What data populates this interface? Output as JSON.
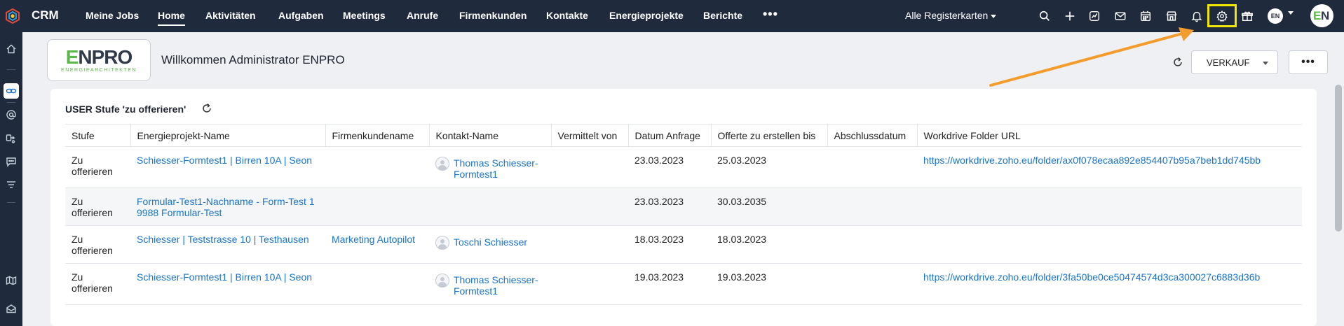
{
  "app": {
    "title": "CRM"
  },
  "nav": {
    "items": [
      {
        "label": "Meine Jobs"
      },
      {
        "label": "Home"
      },
      {
        "label": "Aktivitäten"
      },
      {
        "label": "Aufgaben"
      },
      {
        "label": "Meetings"
      },
      {
        "label": "Anrufe"
      },
      {
        "label": "Firmenkunden"
      },
      {
        "label": "Kontakte"
      },
      {
        "label": "Energieprojekte"
      },
      {
        "label": "Berichte"
      }
    ],
    "more": "•••",
    "tabs_dropdown": "Alle Registerkarten",
    "lang": "EN"
  },
  "icons": {
    "toolbar": [
      "search-icon",
      "plus-icon",
      "activity-chart-icon",
      "mail-icon",
      "calendar-icon",
      "store-icon",
      "bell-icon",
      "settings-icon",
      "gift-icon"
    ],
    "sidebar": [
      "home-icon",
      "link-icon",
      "at-sign-icon",
      "share-icon",
      "chat-icon",
      "filter-icon",
      "map-icon",
      "inbox-icon"
    ]
  },
  "header": {
    "logo_main_green": "E",
    "logo_main": "NPRO",
    "logo_sub": "ENERGIEARCHITEKTEN",
    "welcome": "Willkommen Administrator ENPRO",
    "view_select": "VERKAUF",
    "more": "•••"
  },
  "card": {
    "title": "USER Stufe 'zu offerieren'",
    "columns": [
      "Stufe",
      "Energieprojekt-Name",
      "Firmenkundename",
      "Kontakt-Name",
      "Vermittelt von",
      "Datum Anfrage",
      "Offerte zu erstellen bis",
      "Abschlussdatum",
      "Workdrive Folder URL"
    ],
    "rows": [
      {
        "stufe": "Zu offerieren",
        "projekt": "Schiesser-Formtest1 | Birren 10A | Seon",
        "firma": "",
        "kontakt": "Thomas Schiesser-Formtest1",
        "vermittelt": "",
        "datum": "23.03.2023",
        "offerte": "25.03.2023",
        "abschluss": "",
        "url": "https://workdrive.zoho.eu/folder/ax0f078ecaa892e854407b95a7beb1dd745bb"
      },
      {
        "stufe": "Zu offerieren",
        "projekt": "Formular-Test1-Nachname - Form-Test 1 9988 Formular-Test",
        "firma": "",
        "kontakt": "",
        "vermittelt": "",
        "datum": "23.03.2023",
        "offerte": "30.03.2035",
        "abschluss": "",
        "url": ""
      },
      {
        "stufe": "Zu offerieren",
        "projekt": "Schiesser | Teststrasse 10 | Testhausen",
        "firma": "Marketing Autopilot",
        "kontakt": "Toschi Schiesser",
        "vermittelt": "",
        "datum": "18.03.2023",
        "offerte": "18.03.2023",
        "abschluss": "",
        "url": ""
      },
      {
        "stufe": "Zu offerieren",
        "projekt": "Schiesser-Formtest1 | Birren 10A | Seon",
        "firma": "",
        "kontakt": "Thomas Schiesser-Formtest1",
        "vermittelt": "",
        "datum": "19.03.2023",
        "offerte": "19.03.2023",
        "abschluss": "",
        "url": "https://workdrive.zoho.eu/folder/3fa50be0ce50474574d3ca300027c6883d36b"
      }
    ]
  },
  "colors": {
    "topbar": "#1f2a3c",
    "link": "#1a73c8",
    "highlight": "#f0e800",
    "arrow": "#f39c2b",
    "brand_green": "#5cb84a"
  }
}
